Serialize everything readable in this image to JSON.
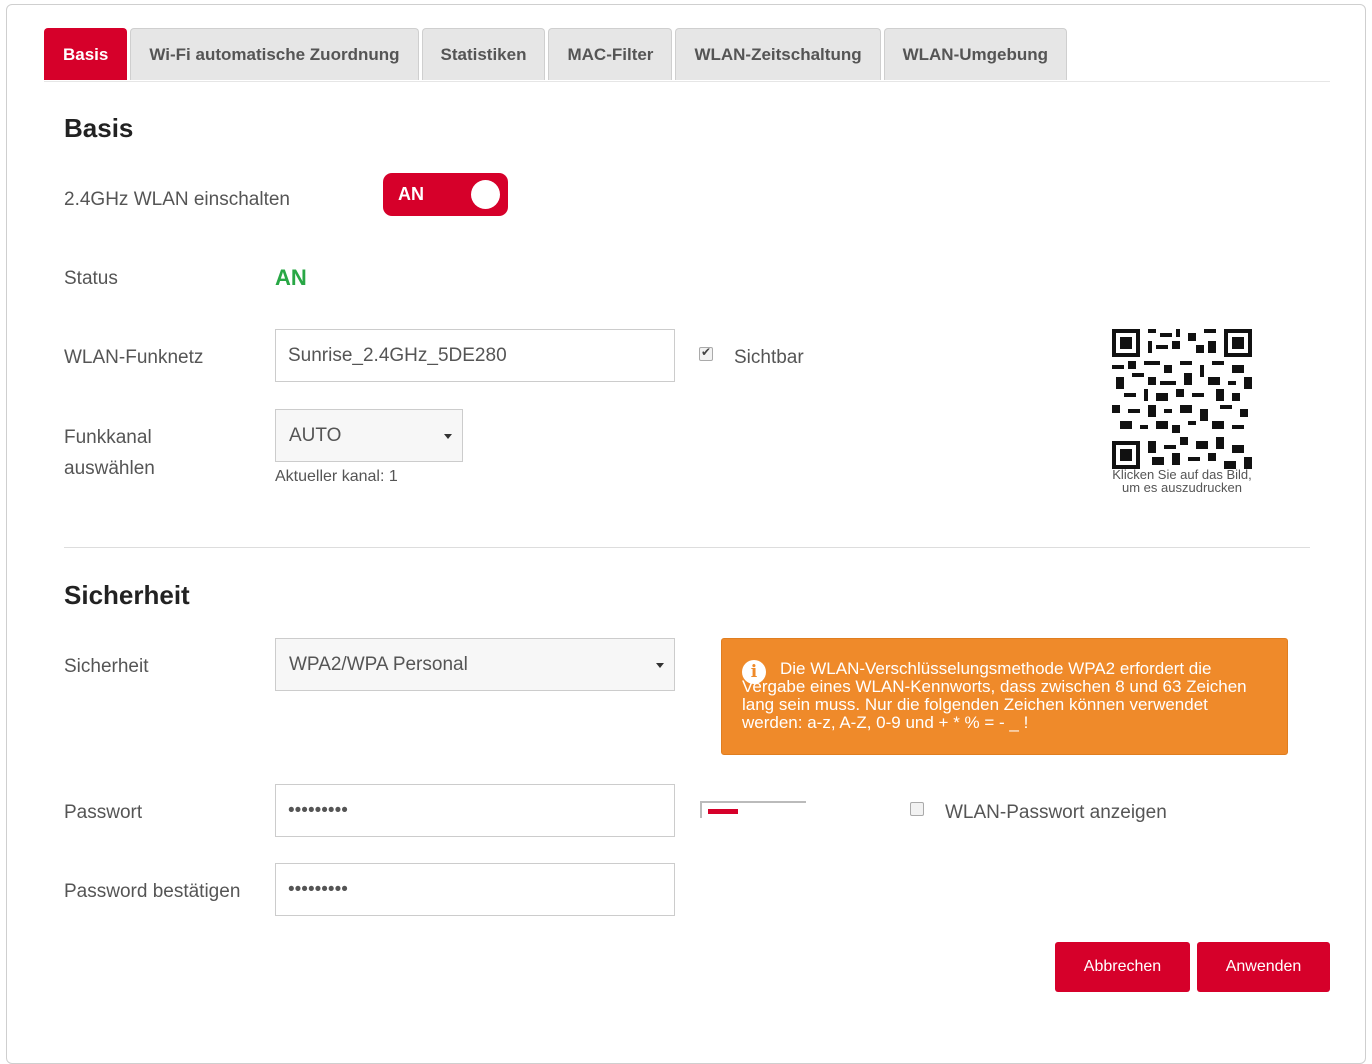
{
  "tabs": [
    "Basis",
    "Wi-Fi automatische Zuordnung",
    "Statistiken",
    "MAC-Filter",
    "WLAN-Zeitschaltung",
    "WLAN-Umgebung"
  ],
  "active_tab": "Basis",
  "basis": {
    "title": "Basis",
    "wlan_label": "2.4GHz WLAN einschalten",
    "wlan_toggle": "AN",
    "status_label": "Status",
    "status_value": "AN",
    "ssid_label": "WLAN-Funknetz",
    "ssid_value": "Sunrise_2.4GHz_5DE280",
    "visible_label": "Sichtbar",
    "visible_checked": true,
    "channel_label_1": "Funkkanal",
    "channel_label_2": "auswählen",
    "channel_value": "AUTO",
    "current_channel": "Aktueller kanal: 1",
    "qr_caption": "Klicken Sie auf das Bild, um es auszudrucken"
  },
  "security": {
    "title": "Sicherheit",
    "security_label": "Sicherheit",
    "security_value": "WPA2/WPA Personal",
    "info_text": "Die WLAN-Verschlüsselungsmethode WPA2 erfordert die Vergabe eines WLAN-Kennworts, dass zwischen 8 und 63 Zeichen lang sein muss. Nur die folgenden Zeichen können verwendet werden: a-z, A-Z, 0-9 und + * % = - _ !",
    "password_label": "Passwort",
    "password_value": "•••••••••",
    "confirm_label": "Password bestätigen",
    "confirm_value": "•••••••••",
    "show_password_label": "WLAN-Passwort anzeigen",
    "show_password_checked": false,
    "strength_level": 0.3
  },
  "buttons": {
    "cancel": "Abbrechen",
    "apply": "Anwenden"
  },
  "colors": {
    "accent": "#d6002a",
    "status_on": "#28a745",
    "alert": "#ef8a2a"
  },
  "icons": {
    "info": "info-icon",
    "qr": "qr-code-icon"
  }
}
